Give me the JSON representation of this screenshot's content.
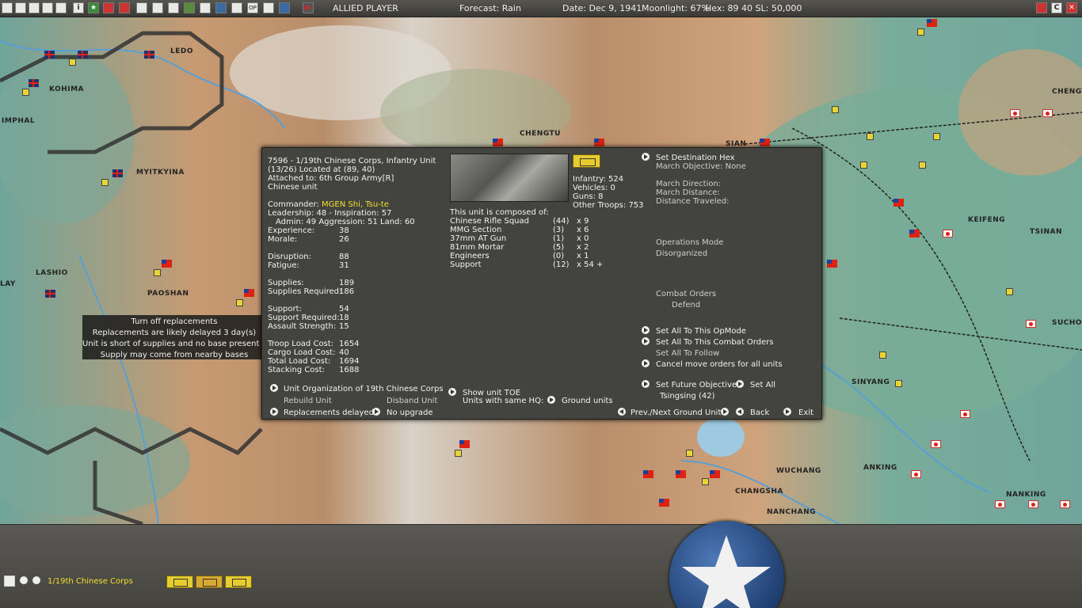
{
  "topbar": {
    "player": "ALLIED PLAYER",
    "forecast": "Forecast: Rain",
    "date": "Date: Dec 9, 1941",
    "moonlight": "Moonlight: 67%",
    "hex": "Hex: 89  40  SL: 50,000",
    "buttons": [
      "N",
      "A",
      "S",
      "T",
      "i",
      "L",
      "C"
    ],
    "right_buttons": [
      "?",
      "C",
      "X"
    ]
  },
  "map": {
    "cities": [
      "LEDO",
      "KOHIMA",
      "IMPHAL",
      "MYITKYINA",
      "LASHIO",
      "PAOSHAN",
      "LAY",
      "CHENGTU",
      "SIAN",
      "KEIFENG",
      "TSINAN",
      "CHENGT",
      "SUCHOW",
      "SINYANG",
      "ANKING",
      "NANKING",
      "WUCHANG",
      "CHANGSHA",
      "NANCHANG"
    ]
  },
  "tooltip": {
    "lines": [
      "Turn off replacements",
      "Replacements are likely delayed 3 day(s)",
      "Unit is short of supplies and no base present in hex",
      "Supply may come from nearby bases"
    ]
  },
  "unit": {
    "title": "7596 - 1/19th Chinese Corps, Infantry Unit",
    "location": "(13/26) Located at (89, 40)",
    "attached": "Attached to:  6th Group Army[R]",
    "nationality": "Chinese unit",
    "commander_label": "Commander: ",
    "commander_name": "MGEN Shi, Tsu-te",
    "leadership": "Leadership: 48 - Inspiration: 57",
    "admin": "Admin: 49  Aggression: 51  Land: 60",
    "stats": [
      {
        "label": "Experience:",
        "value": "38"
      },
      {
        "label": "Morale:",
        "value": "26"
      },
      {
        "label": "Disruption:",
        "value": "88"
      },
      {
        "label": "Fatigue:",
        "value": "31"
      },
      {
        "label": "Supplies:",
        "value": "189"
      },
      {
        "label": "Supplies Required:",
        "value": "186"
      },
      {
        "label": "Support:",
        "value": "54"
      },
      {
        "label": "Support Required:",
        "value": "18"
      },
      {
        "label": "Assault Strength:",
        "value": "15"
      },
      {
        "label": "Troop Load Cost:",
        "value": "1654"
      },
      {
        "label": "Cargo Load Cost:",
        "value": "40"
      },
      {
        "label": "Total Load Cost:",
        "value": "1694"
      },
      {
        "label": "Stacking Cost:",
        "value": "1688"
      }
    ],
    "strength": {
      "infantry": "Infantry: 524",
      "vehicles": "Vehicles: 0",
      "guns": "Guns: 8",
      "other": "Other Troops: 753"
    },
    "composed_label": "This unit is composed of:",
    "composition": [
      {
        "name": "Chinese Rifle Squad",
        "count": "(44)",
        "mult": "x 9"
      },
      {
        "name": "MMG Section",
        "count": "(3)",
        "mult": "x 6"
      },
      {
        "name": "37mm AT Gun",
        "count": "(1)",
        "mult": "x 0"
      },
      {
        "name": "81mm Mortar",
        "count": "(5)",
        "mult": "x 2"
      },
      {
        "name": "Engineers",
        "count": "(0)",
        "mult": "x 1"
      },
      {
        "name": "Support",
        "count": "(12)",
        "mult": "x 54 +"
      }
    ],
    "right": {
      "set_destination": "Set Destination Hex",
      "march_objective": "March Objective: None",
      "march_direction": "March Direction:",
      "march_distance": "March Distance:",
      "distance_traveled": "Distance Traveled:",
      "ops_mode_label": "Operations Mode",
      "ops_mode_value": "Disorganized",
      "combat_orders_label": "Combat Orders",
      "combat_orders_value": "Defend",
      "set_all_opmode": "Set All To This OpMode",
      "set_all_combat": "Set All To This Combat Orders",
      "set_all_follow": "Set All To Follow",
      "cancel_move": "Cancel move orders for all units",
      "set_future_objective": "Set Future Objective",
      "set_all": "Set All",
      "objective_value": "Tsingsing (42)"
    },
    "footer": {
      "unit_org": "Unit Organization of 19th Chinese Corps",
      "rebuild": "Rebuild Unit",
      "disband": "Disband Unit",
      "replacements": "Replacements delayed",
      "no_upgrade": "No upgrade",
      "show_toe": "Show unit TOE",
      "units_same_hq": "Units with same HQ:",
      "ground_units": "Ground units",
      "prev_next": "Prev./Next Ground Unit",
      "back": "Back",
      "exit": "Exit"
    }
  },
  "bottom": {
    "selected_unit": "1/19th Chinese Corps"
  }
}
